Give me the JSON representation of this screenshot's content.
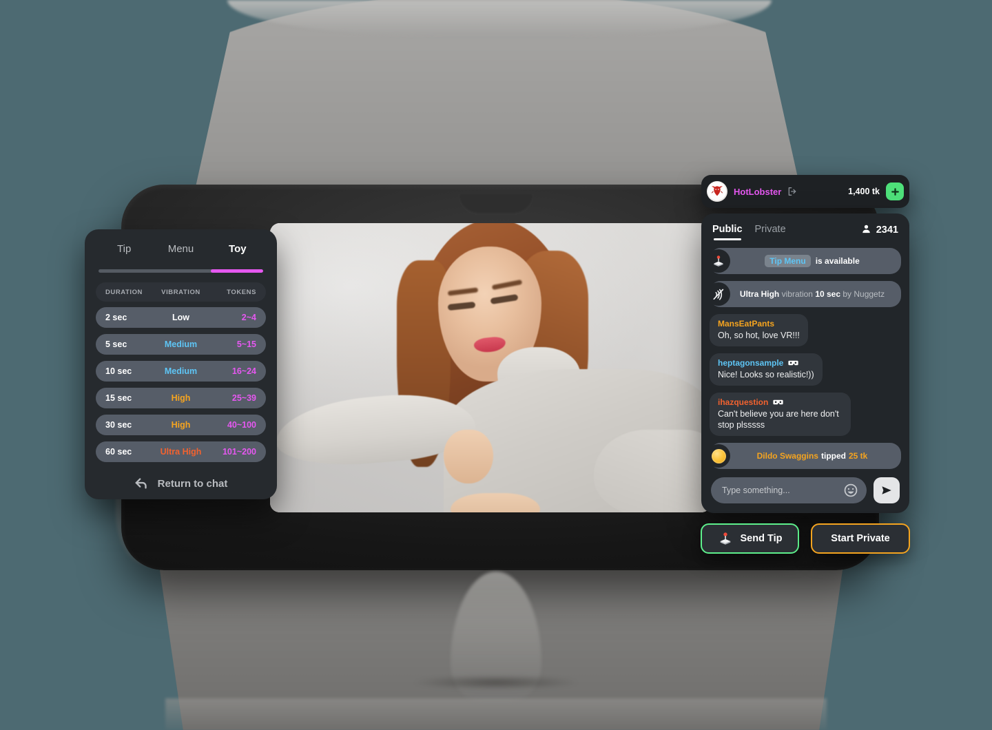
{
  "tip_menu": {
    "tabs": [
      {
        "label": "Tip",
        "active": false
      },
      {
        "label": "Menu",
        "active": false
      },
      {
        "label": "Toy",
        "active": true
      }
    ],
    "columns": {
      "duration": "DURATION",
      "vibration": "VIBRATION",
      "tokens": "TOKENS"
    },
    "rows": [
      {
        "duration": "2 sec",
        "vibration": "Low",
        "vibration_color": "#ffffff",
        "tokens": "2~4"
      },
      {
        "duration": "5 sec",
        "vibration": "Medium",
        "vibration_color": "#5ec5f5",
        "tokens": "5~15"
      },
      {
        "duration": "10 sec",
        "vibration": "Medium",
        "vibration_color": "#5ec5f5",
        "tokens": "16~24"
      },
      {
        "duration": "15 sec",
        "vibration": "High",
        "vibration_color": "#f5a41f",
        "tokens": "25~39"
      },
      {
        "duration": "30 sec",
        "vibration": "High",
        "vibration_color": "#f5a41f",
        "tokens": "40~100"
      },
      {
        "duration": "60 sec",
        "vibration": "Ultra High",
        "vibration_color": "#f2622f",
        "tokens": "101~200"
      }
    ],
    "return_label": "Return to chat",
    "return_icon": "undo-arrow-icon",
    "accent_color": "#e558f0",
    "progress_percent": 32
  },
  "chat_header": {
    "avatar_icon": "lobster-avatar",
    "username": "HotLobster",
    "username_color": "#e558f0",
    "logout_icon": "logout-icon",
    "tokens": "1,400 tk",
    "add_tokens_icon": "plus-icon",
    "add_tokens_color": "#4ee07a"
  },
  "chat": {
    "tabs": [
      {
        "label": "Public",
        "active": true
      },
      {
        "label": "Private",
        "active": false
      }
    ],
    "viewers_icon": "person-icon",
    "viewers_count": "2341",
    "messages": [
      {
        "kind": "system",
        "icon": "joystick-icon",
        "chip": "Tip Menu",
        "text": "is available"
      },
      {
        "kind": "system",
        "icon": "vibration-icon",
        "part1": "Ultra High",
        "part2": "vibration",
        "part3": "10 sec",
        "part4": "by Nuggetz"
      },
      {
        "kind": "user",
        "name": "MansEatPants",
        "name_color": "#f5a41f",
        "vr": false,
        "text": "Oh, so hot, love VR!!!"
      },
      {
        "kind": "user",
        "name": "heptagonsample",
        "name_color": "#5ec5f5",
        "vr": true,
        "text": "Nice! Looks so realistic!))"
      },
      {
        "kind": "user",
        "name": "ihazquestion",
        "name_color": "#f2622f",
        "vr": true,
        "text": "Can't believe you are here don't stop plsssss"
      },
      {
        "kind": "tip",
        "icon": "coin-icon",
        "tipper": "Dildo Swaggins",
        "verb": "tipped",
        "amount": "25 tk"
      }
    ],
    "input_placeholder": "Type something...",
    "emoji_icon": "smiley-icon",
    "send_icon": "send-icon"
  },
  "actions": {
    "send_tip": {
      "label": "Send Tip",
      "icon": "joystick-icon",
      "border_color": "#5ef08c"
    },
    "start_private": {
      "label": "Start Private",
      "border_color": "#f5a41f"
    }
  },
  "video": {
    "alt": "live-cam-stream"
  }
}
